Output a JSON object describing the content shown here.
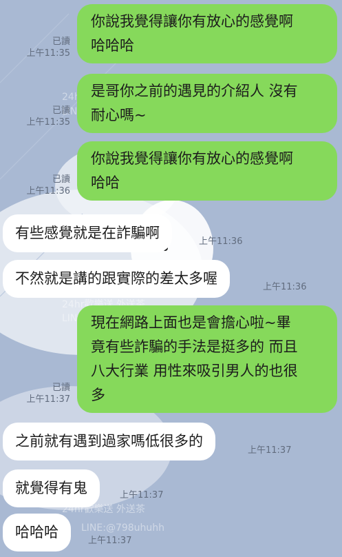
{
  "chat": {
    "messages": [
      {
        "dir": "out",
        "text": "你說我覺得讓你有放心的感覺啊\n哈哈哈",
        "read": "已讀",
        "time": "上午11:35"
      },
      {
        "dir": "out",
        "text": "是哥你之前的遇見的介紹人 沒有\n耐心嗎~",
        "read": "已讀",
        "time": "上午11:35"
      },
      {
        "dir": "out",
        "text": "你說我覺得讓你有放心的感覺啊\n哈哈",
        "read": "已讀",
        "time": "上午11:36"
      },
      {
        "dir": "in",
        "text": "有些感覺就是在詐騙啊",
        "time": "上午11:36"
      },
      {
        "dir": "in",
        "text": "不然就是講的跟實際的差太多喔",
        "time": "上午11:36"
      },
      {
        "dir": "out",
        "text": "現在網路上面也是會擔心啦~畢\n竟有些詐騙的手法是挺多的 而且\n八大行業 用性來吸引男人的也很\n多",
        "read": "已讀",
        "time": "上午11:37"
      },
      {
        "dir": "in",
        "text": "之前就有遇到過家嗎低很多的",
        "time": "上午11:37"
      },
      {
        "dir": "in",
        "text": "就覺得有鬼",
        "time": "上午11:37"
      },
      {
        "dir": "in",
        "text": "哈哈哈",
        "time": "上午11:37"
      }
    ],
    "watermark": {
      "line1": "24hr歡樂送 外送茶",
      "line2": "LINE:@798uhuhh"
    }
  },
  "colors": {
    "background": "#a9b9d3",
    "outgoing_bubble": "#86d95b",
    "incoming_bubble": "#ffffff",
    "meta_text": "#616c7e"
  }
}
